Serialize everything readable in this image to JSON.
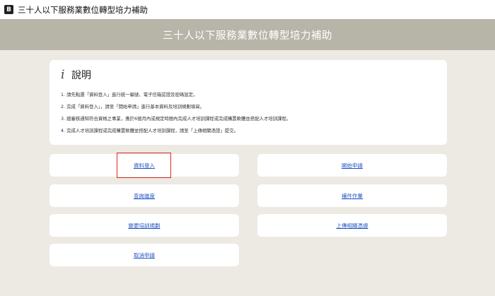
{
  "tab": {
    "favicon_letter": "B",
    "title": "三十人以下服務業數位轉型培力補助"
  },
  "banner": {
    "title": "三十人以下服務業數位轉型培力補助"
  },
  "notice": {
    "icon": "info-icon",
    "icon_glyph": "i",
    "title": "說明",
    "items": [
      "1. 請先點選「資料登入」進行統一編號、電子信箱認證及密碼設定。",
      "2. 完成「資料登入」，請至「開始申請」進行基本資料及培訓規劃填寫。",
      "3. 經審核通知符合資格之事業，應於6個月內或規定時間內完成人才培訓課程或完成購置軟體並搭配人才培訓課程。",
      "4. 完成人才培訓課程或完成購置軟體並搭配人才培訓課程，請至「上傳相關憑證」提交。"
    ]
  },
  "buttons": {
    "login": "資料登入",
    "start_apply": "開始申請",
    "query_progress": "查詢進度",
    "supplement": "補件作業",
    "change_plan": "變更培訓規劃",
    "upload_docs": "上傳相關憑證",
    "cancel_apply": "取消申請"
  },
  "colors": {
    "banner_bg": "#b7b4a8",
    "page_bg": "#eceae3",
    "link": "#2456c6",
    "highlight": "#e0282a"
  }
}
